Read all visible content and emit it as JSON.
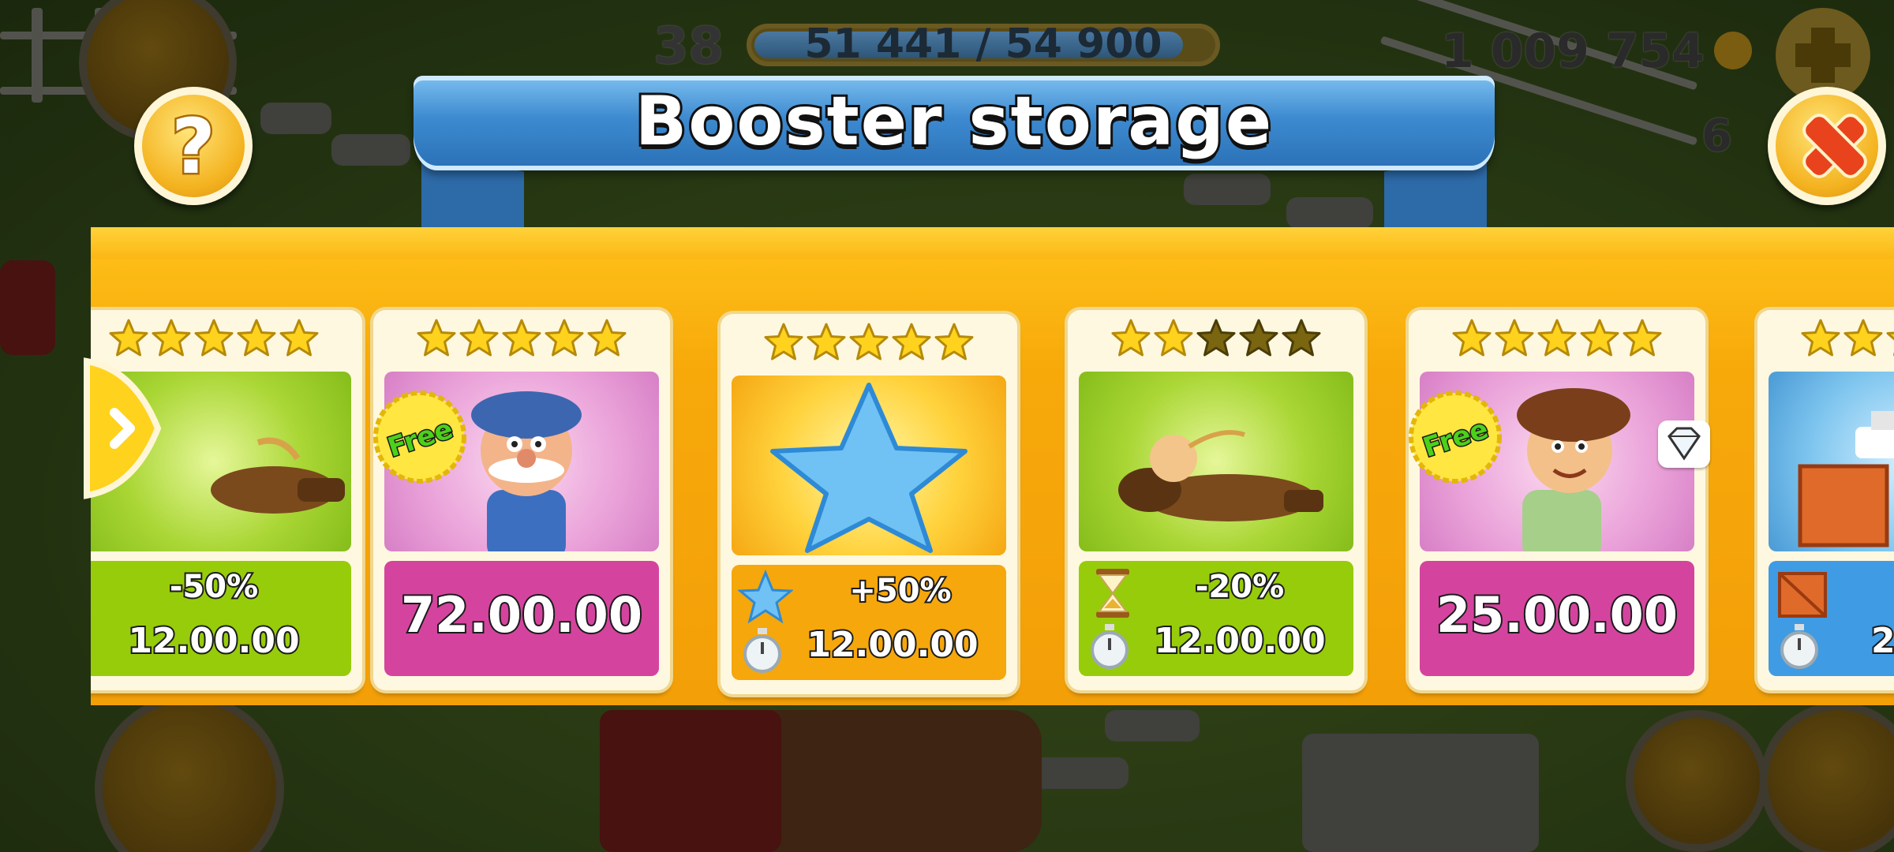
{
  "hud": {
    "level": "38",
    "xp_text": "51 441 / 54 900",
    "xp_progress": 0.937,
    "coins": "1 009 754",
    "gems": "6"
  },
  "dialog": {
    "title": "Booster storage",
    "help_symbol": "?"
  },
  "cards": [
    {
      "stars_filled": 5,
      "image": "sleeping-farmer",
      "theme": "green",
      "bonus": "-50%",
      "duration": "12.00.00",
      "partial": true
    },
    {
      "stars_filled": 5,
      "image": "grandpa-helper",
      "theme": "pink",
      "free_badge": "Free",
      "duration": "72.00.00"
    },
    {
      "stars_filled": 5,
      "image": "blue-star",
      "theme": "orange",
      "bonus": "+50%",
      "duration": "12.00.00",
      "icon": "star-icon"
    },
    {
      "stars_filled": 2,
      "image": "sleeping-farmer",
      "theme": "green",
      "bonus": "-20%",
      "duration": "12.00.00",
      "icon": "hourglass-icon"
    },
    {
      "stars_filled": 5,
      "image": "boy-helper",
      "theme": "pink",
      "free_badge": "Free",
      "duration": "25.00.00",
      "tag_icon": "diamond-icon"
    },
    {
      "stars_filled": 5,
      "image": "crates-boat",
      "theme": "blue",
      "duration": "2",
      "icon": "crate-icon",
      "partial": true
    }
  ],
  "colors": {
    "panel": "#f7a90a",
    "ribbon": "#3d8ad0",
    "green": "#97cc0a",
    "pink": "#d4449e",
    "blue": "#3f9be3",
    "star_filled": "#ffd21e",
    "star_empty": "#7a6510"
  }
}
